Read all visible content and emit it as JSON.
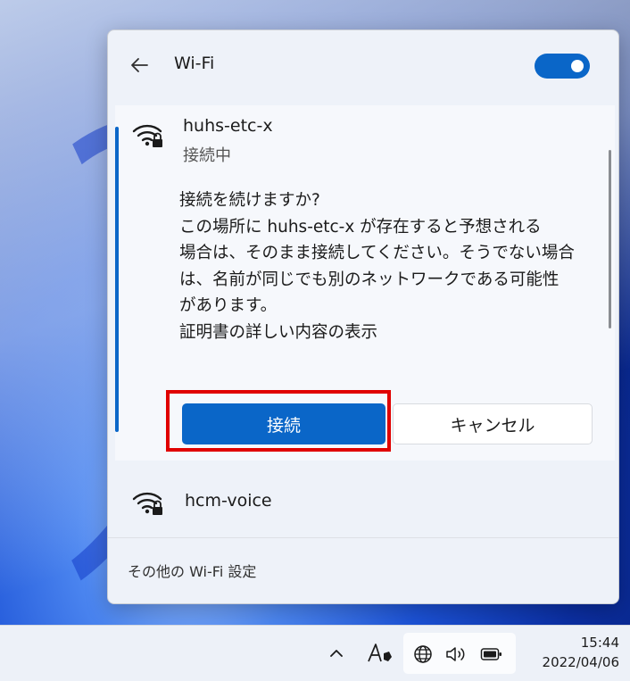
{
  "panel": {
    "title": "Wi-Fi",
    "wifi_enabled": true
  },
  "current_network": {
    "name": "huhs-etc-x",
    "status": "接続中",
    "message_lines": [
      "接続を続けますか?",
      "この場所に huhs-etc-x が存在すると予想される",
      "場合は、そのまま接続してください。そうでない場合",
      "は、名前が同じでも別のネットワークである可能性",
      "があります。",
      "証明書の詳しい内容の表示"
    ],
    "connect_label": "接続",
    "cancel_label": "キャンセル"
  },
  "other_networks": [
    {
      "name": "hcm-voice"
    }
  ],
  "footer": {
    "more_settings": "その他の Wi-Fi 設定"
  },
  "taskbar": {
    "time": "15:44",
    "date": "2022/04/06"
  },
  "colors": {
    "accent": "#0a66c8",
    "highlight": "#e00000"
  }
}
